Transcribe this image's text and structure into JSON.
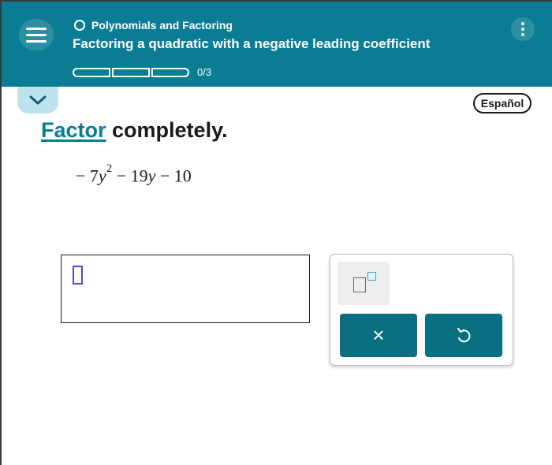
{
  "header": {
    "topic": "Polynomials and Factoring",
    "title": "Factoring a quadratic with a negative leading coefficient",
    "progress": {
      "completed": 0,
      "total": 3,
      "label": "0/3"
    }
  },
  "language_button": "Español",
  "problem": {
    "prompt_link": "Factor",
    "prompt_rest": " completely.",
    "expression": {
      "coef1": "− 7",
      "var1": "y",
      "exp1": "2",
      "op1": " − 19",
      "var2": "y",
      "op2": " − 10"
    }
  },
  "keypad": {
    "clear_symbol": "×",
    "undo_symbol": "↺"
  },
  "colors": {
    "header_bg": "#0a7d95",
    "button_bg": "#0b6f82",
    "accent": "#3aa7c2"
  },
  "icons": [
    "menu-icon",
    "kebab-menu-icon",
    "chevron-down-icon",
    "exponent-icon",
    "clear-icon",
    "undo-icon"
  ]
}
